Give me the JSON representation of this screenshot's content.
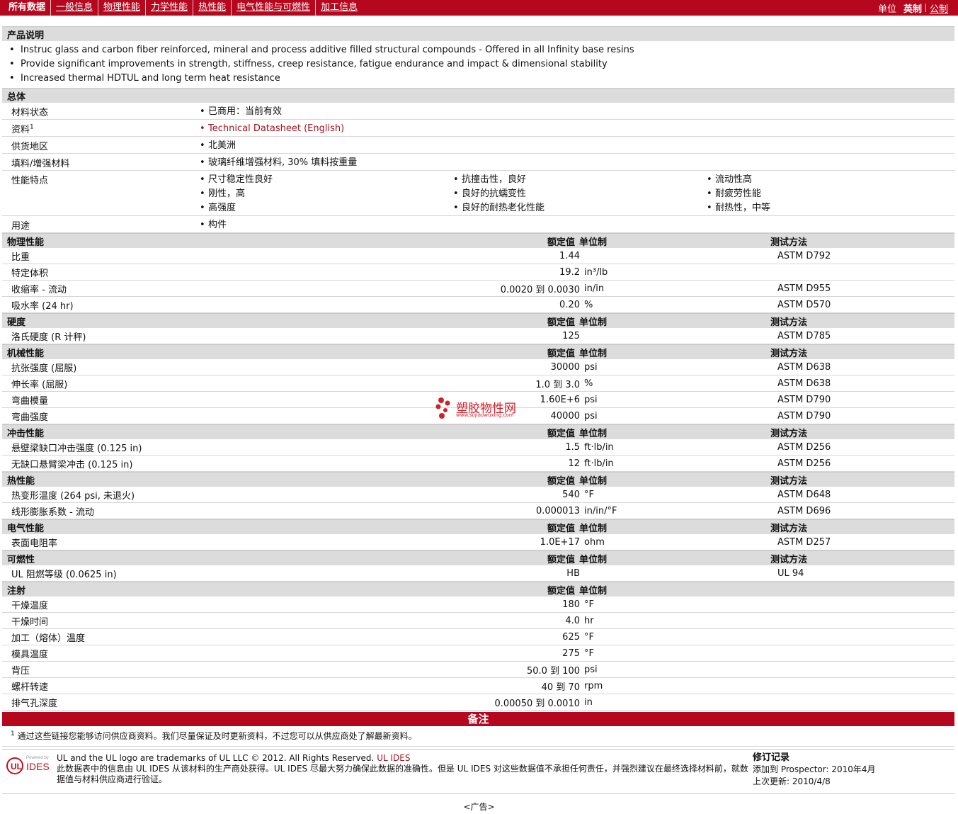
{
  "nav": {
    "tabs": [
      "所有数据",
      "一般信息",
      "物理性能",
      "力学性能",
      "热性能",
      "电气性能与可燃性",
      "加工信息"
    ],
    "units_label": "单位",
    "units_active": "英制",
    "units_other": "公制"
  },
  "description": {
    "title": "产品说明",
    "items": [
      "Instruc glass and carbon fiber reinforced, mineral and process additive filled structural compounds - Offered in all Infinity base resins",
      "Provide significant improvements in strength, stiffness, creep resistance, fatigue endurance and impact & dimensional stability",
      "Increased thermal HDTUL and long term heat resistance"
    ]
  },
  "general": {
    "title": "总体",
    "rows": [
      {
        "label": "材料状态",
        "sup": "",
        "values": [
          "已商用：当前有效"
        ]
      },
      {
        "label": "资料",
        "sup": "1",
        "values": [
          "Technical Datasheet (English)"
        ]
      },
      {
        "label": "供货地区",
        "sup": "",
        "values": [
          "北美洲"
        ]
      },
      {
        "label": "填料/增强材料",
        "sup": "",
        "values": [
          "玻璃纤维增强材料, 30% 填料按重量"
        ]
      }
    ],
    "features": {
      "label": "性能特点",
      "columns": [
        [
          "尺寸稳定性良好",
          "刚性，高",
          "高强度"
        ],
        [
          "抗撞击性，良好",
          "良好的抗蠕变性",
          "良好的耐热老化性能"
        ],
        [
          "流动性高",
          "耐疲劳性能",
          "耐热性，中等"
        ]
      ]
    },
    "usage": {
      "label": "用途",
      "values": [
        "构件"
      ]
    }
  },
  "headers": {
    "nominal": "额定值",
    "unit": "单位制",
    "test": "测试方法"
  },
  "sections": [
    {
      "title": "物理性能",
      "show_test": true,
      "rows": [
        {
          "label": "比重",
          "value": "1.44",
          "unit": "",
          "test": "ASTM D792"
        },
        {
          "label": "特定体积",
          "value": "19.2",
          "unit": "in³/lb",
          "test": ""
        },
        {
          "label": "收缩率 - 流动",
          "value": "0.0020 到 0.0030",
          "unit": "in/in",
          "test": "ASTM D955"
        },
        {
          "label": "吸水率 (24 hr)",
          "value": "0.20",
          "unit": "%",
          "test": "ASTM D570"
        }
      ]
    },
    {
      "title": "硬度",
      "show_test": true,
      "rows": [
        {
          "label": "洛氏硬度 (R 计秤)",
          "value": "125",
          "unit": "",
          "test": "ASTM D785"
        }
      ]
    },
    {
      "title": "机械性能",
      "show_test": true,
      "rows": [
        {
          "label": "抗张强度 (屈服)",
          "value": "30000",
          "unit": "psi",
          "test": "ASTM D638"
        },
        {
          "label": "伸长率 (屈服)",
          "value": "1.0 到 3.0",
          "unit": "%",
          "test": "ASTM D638"
        },
        {
          "label": "弯曲模量",
          "value": "1.60E+6",
          "unit": "psi",
          "test": "ASTM D790"
        },
        {
          "label": "弯曲强度",
          "value": "40000",
          "unit": "psi",
          "test": "ASTM D790"
        }
      ]
    },
    {
      "title": "冲击性能",
      "show_test": true,
      "rows": [
        {
          "label": "悬壁梁缺口冲击强度 (0.125 in)",
          "value": "1.5",
          "unit": "ft·lb/in",
          "test": "ASTM D256"
        },
        {
          "label": "无缺口悬臂梁冲击 (0.125 in)",
          "value": "12",
          "unit": "ft·lb/in",
          "test": "ASTM D256"
        }
      ]
    },
    {
      "title": "热性能",
      "show_test": true,
      "rows": [
        {
          "label": "热变形温度 (264 psi, 未退火)",
          "value": "540",
          "unit": "°F",
          "test": "ASTM D648"
        },
        {
          "label": "线形膨胀系数 - 流动",
          "value": "0.000013",
          "unit": "in/in/°F",
          "test": "ASTM D696"
        }
      ]
    },
    {
      "title": "电气性能",
      "show_test": true,
      "rows": [
        {
          "label": "表面电阻率",
          "value": "1.0E+17",
          "unit": "ohm",
          "test": "ASTM D257"
        }
      ]
    },
    {
      "title": "可燃性",
      "show_test": true,
      "rows": [
        {
          "label": "UL 阻燃等级 (0.0625 in)",
          "value": "HB",
          "unit": "",
          "test": "UL 94"
        }
      ]
    },
    {
      "title": "注射",
      "show_test": false,
      "rows": [
        {
          "label": "干燥温度",
          "value": "180",
          "unit": "°F",
          "test": ""
        },
        {
          "label": "干燥时间",
          "value": "4.0",
          "unit": "hr",
          "test": ""
        },
        {
          "label": "加工（熔体）温度",
          "value": "625",
          "unit": "°F",
          "test": ""
        },
        {
          "label": "模具温度",
          "value": "275",
          "unit": "°F",
          "test": ""
        },
        {
          "label": "背压",
          "value": "50.0 到 100",
          "unit": "psi",
          "test": ""
        },
        {
          "label": "螺杆转速",
          "value": "40 到 70",
          "unit": "rpm",
          "test": ""
        },
        {
          "label": "排气孔深度",
          "value": "0.00050 到 0.0010",
          "unit": "in",
          "test": ""
        }
      ]
    }
  ],
  "notes": {
    "title": "备注",
    "sup": "1",
    "text": "通过这些链接您能够访问供应商资料。我们尽量保证及时更新资料，不过您可以从供应商处了解最新资料。"
  },
  "watermark": {
    "text": "塑胶物性网",
    "url": "www.sujiaowuxing.com"
  },
  "footer": {
    "logo_small": "Powered by",
    "logo_text": "IDES",
    "trademark": "UL and the UL logo are trademarks of UL LLC © 2012. All Rights Reserved.",
    "ul_ides": "UL IDES",
    "disclaimer": "此数据表中的信息由 UL IDES 从该材料的生产商处获得。UL IDES 尽最大努力确保此数据的准确性。但是 UL IDES 对这些数据值不承担任何责任，并强烈建议在最终选择材料前，就数据值与材料供应商进行验证。",
    "history_title": "修订记录",
    "added": "添加到 Prospector: 2010年4月",
    "updated": "上次更新: 2010/4/8"
  },
  "ad": "<广告>",
  "colors": {
    "brand": "#b5081e",
    "link": "#a3141f",
    "section": "#dcdcdc"
  }
}
